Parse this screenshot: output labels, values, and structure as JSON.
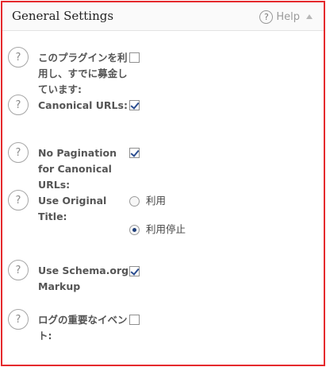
{
  "panel": {
    "title": "General Settings",
    "help_label": "Help",
    "border_color": "#e5282b"
  },
  "settings": [
    {
      "label": "このプラグインを利用し、すでに募金しています:",
      "control": "checkbox",
      "checked": false
    },
    {
      "label": "Canonical URLs:",
      "control": "checkbox",
      "checked": true
    },
    {
      "label": "No Pagination for Canonical URLs:",
      "control": "checkbox",
      "checked": true
    },
    {
      "label": "Use Original Title:",
      "control": "radio",
      "options": [
        {
          "label": "利用",
          "selected": false
        },
        {
          "label": "利用停止",
          "selected": true
        }
      ]
    },
    {
      "label": "Use Schema.org Markup",
      "control": "checkbox",
      "checked": true
    },
    {
      "label": "ログの重要なイベント:",
      "control": "checkbox",
      "checked": false
    }
  ],
  "icons": {
    "help": "question-circle-icon",
    "collapse": "triangle-up-icon"
  }
}
